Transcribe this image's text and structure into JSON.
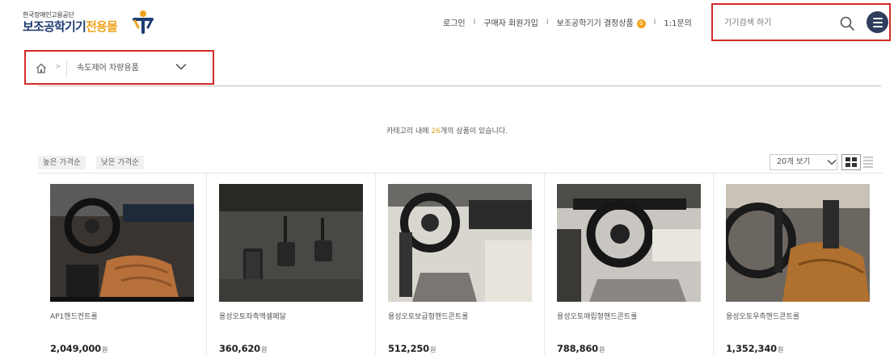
{
  "logo": {
    "subtitle": "한국장애인고용공단",
    "title_main": "보조공학기기",
    "title_accent": "전용몰"
  },
  "topnav": {
    "login": "로그인",
    "separator": "I",
    "signup": "구매자 회원가입",
    "decided": "보조공학기기 결정상품",
    "decided_count": "0",
    "inquiry": "1:1문의"
  },
  "search": {
    "placeholder": "기기검색 하기",
    "icon": "search-icon"
  },
  "menu": {
    "icon": "hamburger-icon"
  },
  "breadcrumb": {
    "home_icon": "home-icon",
    "arrow": ">",
    "category": "속도제어 차량용품"
  },
  "listing": {
    "count_prefix": "카테고리 내에 ",
    "count": "26",
    "count_suffix": "개의 상품이 있습니다."
  },
  "sort": {
    "high_price": "높은 가격순",
    "low_price": "낮은 가격순"
  },
  "view": {
    "per_page": "20개 보기",
    "grid_icon": "grid-view-icon",
    "list_icon": "list-view-icon"
  },
  "products": [
    {
      "name": "AP1핸드컨트롤",
      "price": "2,049,000",
      "currency": "원"
    },
    {
      "name": "용성오토좌측엑셀페달",
      "price": "360,620",
      "currency": "원"
    },
    {
      "name": "용성오토보급형핸드콘트롤",
      "price": "512,250",
      "currency": "원"
    },
    {
      "name": "용성오토매립형핸드콘트롤",
      "price": "788,860",
      "currency": "원"
    },
    {
      "name": "용성오토우측핸드콘트롤",
      "price": "1,352,340",
      "currency": "원"
    }
  ],
  "colors": {
    "accent": "#f0a41e",
    "brand_navy": "#1f3c73",
    "highlight_box": "#d42a2a"
  }
}
